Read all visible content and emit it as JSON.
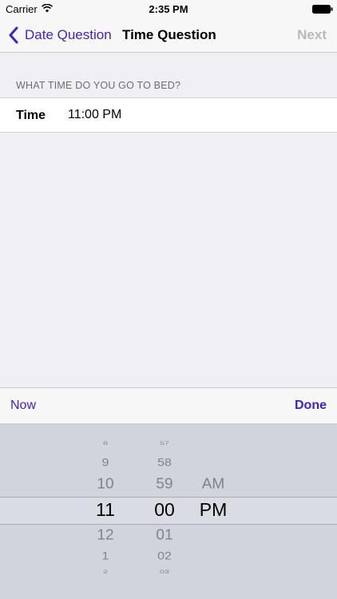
{
  "status_bar": {
    "carrier": "Carrier",
    "time": "2:35 PM"
  },
  "nav": {
    "back_label": "Date Question",
    "title": "Time Question",
    "next_label": "Next"
  },
  "form": {
    "section_header": "WHAT TIME DO YOU GO TO BED?",
    "row_label": "Time",
    "row_value": "11:00 PM"
  },
  "toolbar": {
    "now_label": "Now",
    "done_label": "Done"
  },
  "picker": {
    "hours": [
      "8",
      "9",
      "10",
      "11",
      "12",
      "1",
      "2"
    ],
    "minutes": [
      "57",
      "58",
      "59",
      "00",
      "01",
      "02",
      "03"
    ],
    "periods": [
      "AM",
      "PM"
    ],
    "selected": {
      "hour": "11",
      "minute": "00",
      "period": "PM"
    }
  },
  "colors": {
    "accent": "#3d1fd6",
    "disabled": "#b8b8bd",
    "background": "#efeff4",
    "picker_bg": "#d1d5db"
  }
}
